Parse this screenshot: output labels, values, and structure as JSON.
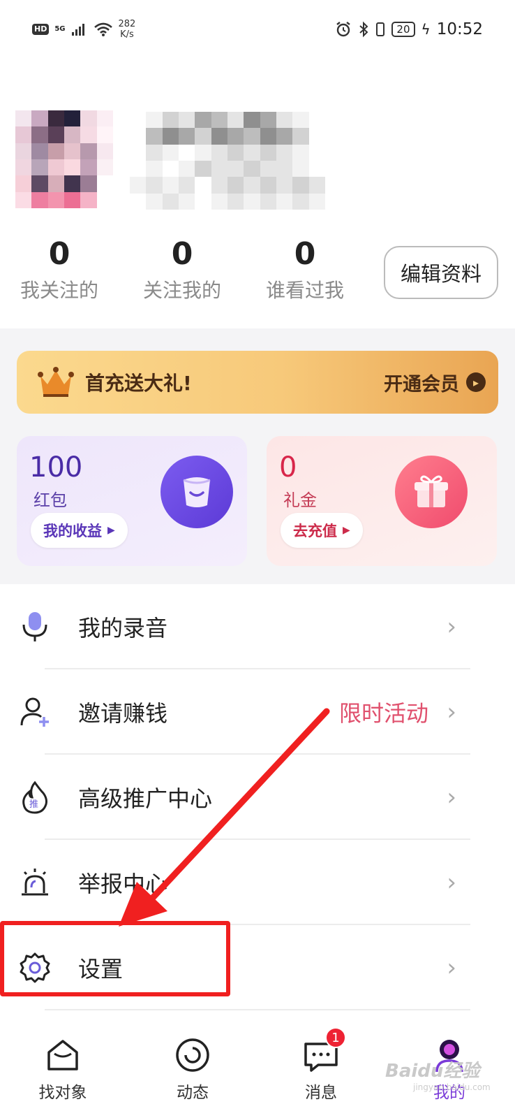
{
  "status_bar": {
    "hd": "HD",
    "network": "5G",
    "speed_value": "282",
    "speed_unit": "K/s",
    "battery": "20",
    "time": "10:52"
  },
  "profile": {
    "stats": [
      {
        "value": "0",
        "label": "我关注的"
      },
      {
        "value": "0",
        "label": "关注我的"
      },
      {
        "value": "0",
        "label": "谁看过我"
      }
    ],
    "edit_label": "编辑资料"
  },
  "vip_banner": {
    "text": "首充送大礼!",
    "action": "开通会员",
    "icon": "crown-icon"
  },
  "cards": [
    {
      "amount": "100",
      "label": "红包",
      "button": "我的收益",
      "icon": "wallet-icon"
    },
    {
      "amount": "0",
      "label": "礼金",
      "button": "去充值",
      "icon": "gift-icon"
    }
  ],
  "menu": [
    {
      "label": "我的录音",
      "extra": "",
      "icon": "microphone-icon"
    },
    {
      "label": "邀请赚钱",
      "extra": "限时活动",
      "icon": "add-user-icon"
    },
    {
      "label": "高级推广中心",
      "extra": "",
      "icon": "flame-icon"
    },
    {
      "label": "举报中心",
      "extra": "",
      "icon": "siren-icon"
    },
    {
      "label": "设置",
      "extra": "",
      "icon": "gear-icon"
    }
  ],
  "bottom_nav": [
    {
      "label": "找对象",
      "icon": "house-icon"
    },
    {
      "label": "动态",
      "icon": "refresh-circle-icon"
    },
    {
      "label": "消息",
      "icon": "chat-icon",
      "badge": "1"
    },
    {
      "label": "我的",
      "icon": "profile-icon",
      "active": true
    }
  ],
  "watermark": "Baidu经验",
  "watermark_sub": "jingyan.baidu.com",
  "colors": {
    "accent": "#7a3ad8",
    "annotation_red": "#f02020",
    "promo_pink": "#e0506d"
  }
}
